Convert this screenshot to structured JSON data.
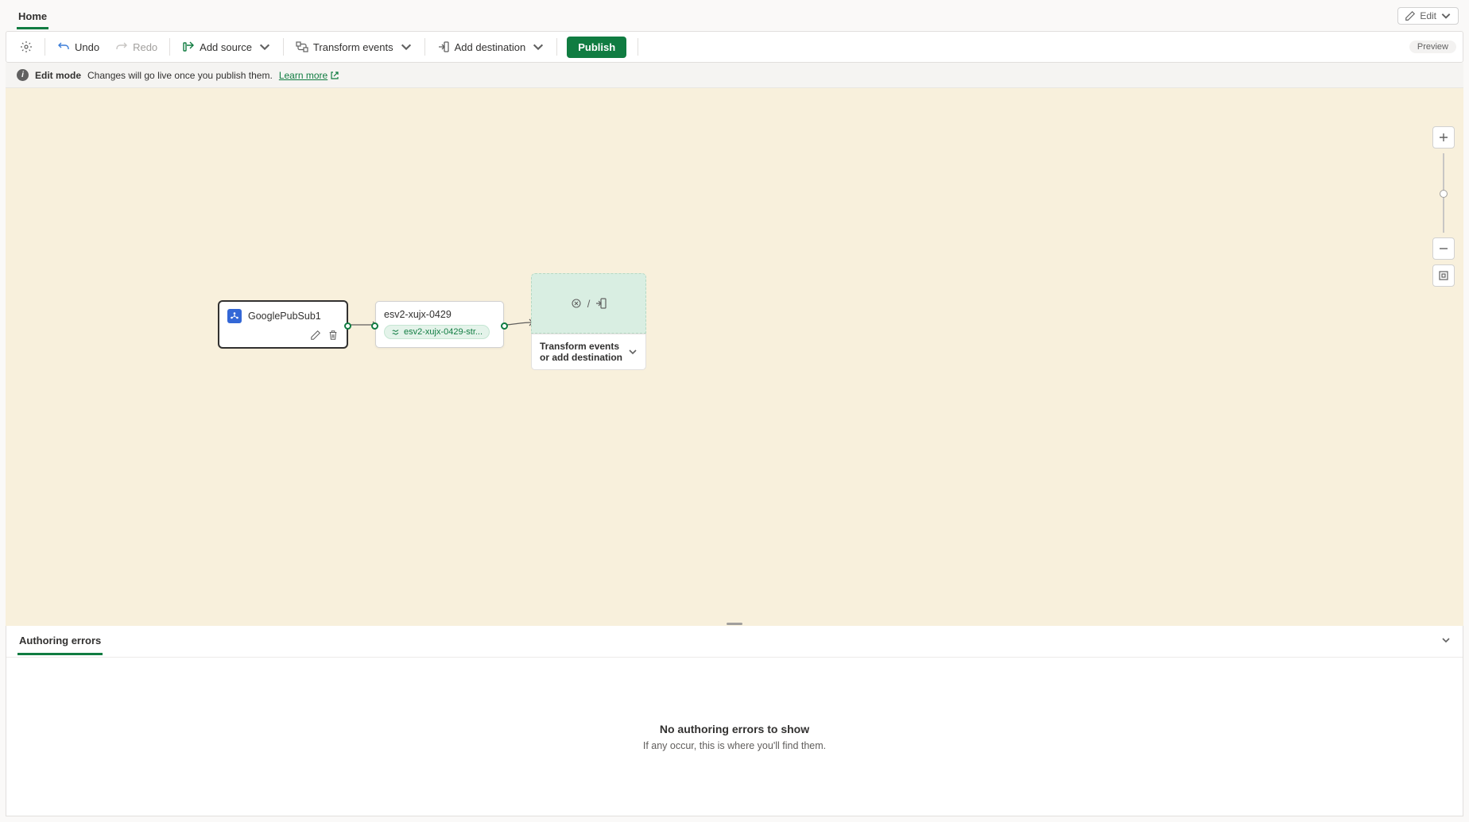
{
  "tabs": {
    "home": "Home"
  },
  "toolbar": {
    "undo": "Undo",
    "redo": "Redo",
    "addSource": "Add source",
    "transformEvents": "Transform events",
    "addDestination": "Add destination",
    "publish": "Publish",
    "edit": "Edit",
    "preview": "Preview"
  },
  "infoBar": {
    "mode": "Edit mode",
    "msg": "Changes will go live once you publish them.",
    "learnMore": "Learn more"
  },
  "nodes": {
    "source": {
      "label": "GooglePubSub1"
    },
    "stream": {
      "label": "esv2-xujx-0429",
      "chip": "esv2-xujx-0429-str..."
    },
    "add": {
      "label": "Transform events or add destination"
    }
  },
  "bottom": {
    "tab": "Authoring errors",
    "emptyTitle": "No authoring errors to show",
    "emptySub": "If any occur, this is where you'll find them."
  }
}
